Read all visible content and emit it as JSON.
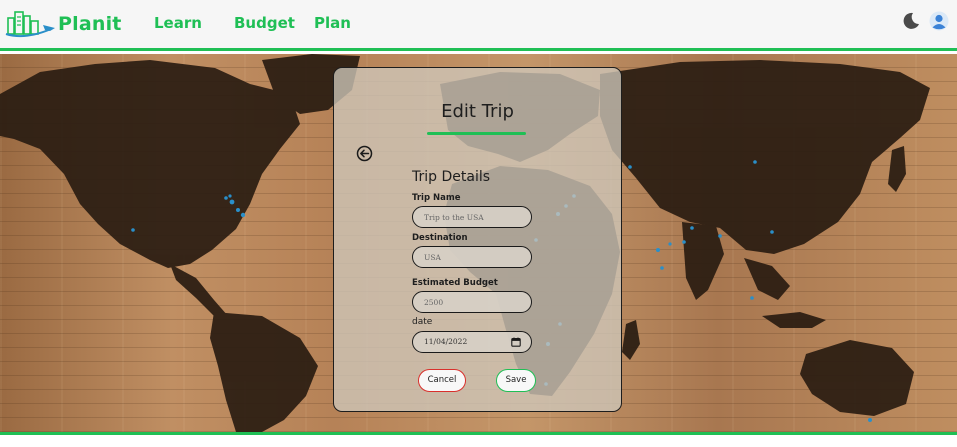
{
  "navbar": {
    "brand": "Planit",
    "brand_icon": "city-plane-logo-icon",
    "links": [
      {
        "label": "Learn"
      },
      {
        "label": "Budget"
      },
      {
        "label": "Plan"
      }
    ],
    "icons": [
      "moon-icon",
      "user-icon"
    ],
    "accent_color": "#1fbf55"
  },
  "background": {
    "image": "world-map-on-wood-planks",
    "colors": {
      "wood": "#b68257",
      "land": "#2b1d12",
      "pins": "#2a8fc9"
    }
  },
  "form": {
    "title": "Edit Trip",
    "back_icon": "arrow-left-circle-icon",
    "section_title": "Trip Details",
    "fields": {
      "trip_name": {
        "label": "Trip Name",
        "placeholder": "Trip to the USA"
      },
      "destination": {
        "label": "Destination",
        "placeholder": "USA"
      },
      "budget": {
        "label": "Estimated Budget",
        "placeholder": "2500"
      },
      "date": {
        "label": "date",
        "value": "11/04/2022",
        "icon": "calendar-icon"
      }
    },
    "buttons": {
      "cancel": "Cancel",
      "save": "Save"
    },
    "colors": {
      "cancel_border": "#d9302c",
      "save_border": "#1fbf55"
    }
  }
}
